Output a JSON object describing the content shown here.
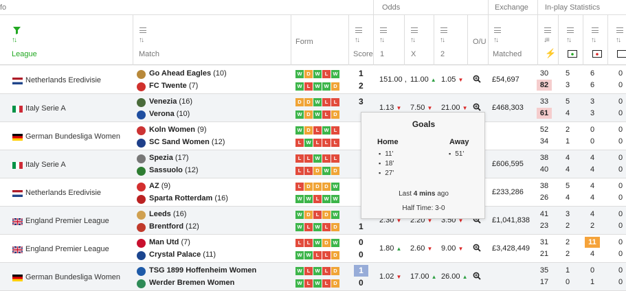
{
  "topbar": {
    "info": "fo",
    "odds": "Odds",
    "exchange": "Exchange",
    "inplay": "In-play Statistics"
  },
  "header": {
    "league": "League",
    "match": "Match",
    "form": "Form",
    "score": "Score",
    "odds1": "1",
    "oddsx": "X",
    "odds2": "2",
    "ou": "O/U",
    "matched": "Matched"
  },
  "colors": {
    "win": "#3db54a",
    "loss": "#e24b3c",
    "draw": "#f0a436",
    "accent": "#22a822"
  },
  "rows": [
    {
      "league": "Netherlands Eredivisie",
      "flag": "nl",
      "home": "Go Ahead Eagles",
      "home_pos": "(10)",
      "away": "FC Twente",
      "away_pos": "(7)",
      "home_form": [
        "W",
        "D",
        "W",
        "L",
        "W"
      ],
      "away_form": [
        "W",
        "L",
        "W",
        "W",
        "D"
      ],
      "home_score": "1",
      "away_score": "2",
      "o1": "151.00",
      "o1_dir": "",
      "ox": "11.00",
      "ox_dir": "up",
      "o2": "1.05",
      "o2_dir": "down",
      "matched": "£54,697",
      "stats": [
        [
          "30",
          "5",
          "6",
          "0"
        ],
        [
          "82",
          "3",
          "6",
          "0"
        ]
      ],
      "hl": "82"
    },
    {
      "league": "Italy Serie A",
      "flag": "it",
      "home": "Venezia",
      "home_pos": "(16)",
      "away": "Verona",
      "away_pos": "(10)",
      "home_form": [
        "D",
        "D",
        "W",
        "L",
        "L"
      ],
      "away_form": [
        "W",
        "D",
        "W",
        "L",
        "D"
      ],
      "home_score": "3",
      "away_score": "",
      "o1": "1.13",
      "o1_dir": "down",
      "ox": "7.50",
      "ox_dir": "down",
      "o2": "21.00",
      "o2_dir": "down",
      "matched": "£468,303",
      "stats": [
        [
          "33",
          "5",
          "3",
          "0"
        ],
        [
          "61",
          "4",
          "3",
          "0"
        ]
      ],
      "hl": "61"
    },
    {
      "league": "German Bundesliga Women",
      "flag": "de",
      "home": "Koln Women",
      "home_pos": "(9)",
      "away": "SC Sand Women",
      "away_pos": "(12)",
      "home_form": [
        "W",
        "D",
        "L",
        "W",
        "L"
      ],
      "away_form": [
        "L",
        "W",
        "L",
        "L",
        "L"
      ],
      "home_score": "",
      "away_score": "",
      "o1": "",
      "ox": "",
      "o2": "",
      "matched": "",
      "stats": [
        [
          "52",
          "2",
          "0",
          "0"
        ],
        [
          "34",
          "1",
          "0",
          "0"
        ]
      ]
    },
    {
      "league": "Italy Serie A",
      "flag": "it",
      "home": "Spezia",
      "home_pos": "(17)",
      "away": "Sassuolo",
      "away_pos": "(12)",
      "home_form": [
        "L",
        "L",
        "W",
        "L",
        "L"
      ],
      "away_form": [
        "L",
        "L",
        "D",
        "W",
        "D"
      ],
      "home_score": "",
      "away_score": "",
      "o1": "",
      "ox": "",
      "o2": "",
      "matched": "£606,595",
      "stats": [
        [
          "38",
          "4",
          "4",
          "0"
        ],
        [
          "40",
          "4",
          "4",
          "0"
        ]
      ]
    },
    {
      "league": "Netherlands Eredivisie",
      "flag": "nl",
      "home": "AZ",
      "home_pos": "(9)",
      "away": "Sparta Rotterdam",
      "away_pos": "(16)",
      "home_form": [
        "L",
        "D",
        "D",
        "D",
        "W"
      ],
      "away_form": [
        "W",
        "W",
        "L",
        "W",
        "W"
      ],
      "home_score": "",
      "away_score": "",
      "o1": "",
      "ox": "",
      "o2": "",
      "matched": "£233,286",
      "stats": [
        [
          "38",
          "5",
          "4",
          "0"
        ],
        [
          "26",
          "4",
          "4",
          "0"
        ]
      ]
    },
    {
      "league": "England Premier League",
      "flag": "gb",
      "home": "Leeds",
      "home_pos": "(16)",
      "away": "Brentford",
      "away_pos": "(12)",
      "home_form": [
        "W",
        "D",
        "L",
        "D",
        "W"
      ],
      "away_form": [
        "W",
        "L",
        "W",
        "L",
        "D"
      ],
      "home_score": "",
      "away_score": "1",
      "o1": "2.30",
      "o1_dir": "down",
      "ox": "2.20",
      "ox_dir": "down",
      "o2": "3.50",
      "o2_dir": "down",
      "matched": "£1,041,838",
      "stats": [
        [
          "41",
          "3",
          "4",
          "0"
        ],
        [
          "23",
          "2",
          "2",
          "0"
        ]
      ]
    },
    {
      "league": "England Premier League",
      "flag": "gb",
      "home": "Man Utd",
      "home_pos": "(7)",
      "away": "Crystal Palace",
      "away_pos": "(11)",
      "home_form": [
        "L",
        "L",
        "W",
        "D",
        "W"
      ],
      "away_form": [
        "W",
        "W",
        "L",
        "L",
        "D"
      ],
      "home_score": "0",
      "away_score": "0",
      "o1": "1.80",
      "o1_dir": "up",
      "ox": "2.60",
      "ox_dir": "down",
      "o2": "9.00",
      "o2_dir": "down",
      "matched": "£3,428,449",
      "stats": [
        [
          "31",
          "2",
          "11",
          "0"
        ],
        [
          "21",
          "2",
          "4",
          "0"
        ]
      ],
      "hl_org": "11"
    },
    {
      "league": "German Bundesliga Women",
      "flag": "de",
      "home": "TSG 1899 Hoffenheim Women",
      "home_pos": "",
      "away": "Werder Bremen Women",
      "away_pos": "",
      "home_form": [
        "W",
        "L",
        "W",
        "L",
        "D"
      ],
      "away_form": [
        "W",
        "L",
        "W",
        "L",
        "D"
      ],
      "home_score": "1",
      "away_score": "0",
      "o1": "1.02",
      "o1_dir": "down",
      "ox": "17.00",
      "ox_dir": "up",
      "o2": "26.00",
      "o2_dir": "up",
      "matched": "",
      "stats": [
        [
          "35",
          "1",
          "0",
          "0"
        ],
        [
          "17",
          "0",
          "1",
          "0"
        ]
      ]
    }
  ],
  "popup": {
    "title": "Goals",
    "home_label": "Home",
    "away_label": "Away",
    "home_goals": [
      "11'",
      "18'",
      "27'"
    ],
    "away_goals": [
      "51'"
    ],
    "last_prefix": "Last ",
    "last_bold": "4 mins",
    "last_suffix": " ago",
    "half_time": "Half Time: 3-0"
  }
}
